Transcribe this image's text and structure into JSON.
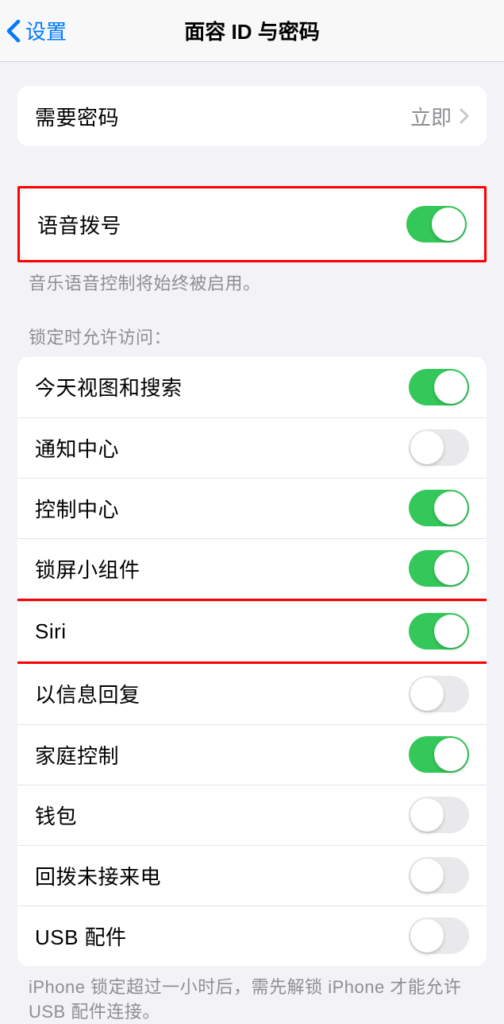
{
  "nav": {
    "back_label": "设置",
    "title": "面容 ID 与密码"
  },
  "require_passcode": {
    "label": "需要密码",
    "value": "立即"
  },
  "voice_dial": {
    "label": "语音拨号",
    "enabled": true,
    "footer": "音乐语音控制将始终被启用。"
  },
  "lock_access": {
    "header": "锁定时允许访问：",
    "items": [
      {
        "label": "今天视图和搜索",
        "enabled": true
      },
      {
        "label": "通知中心",
        "enabled": false
      },
      {
        "label": "控制中心",
        "enabled": true
      },
      {
        "label": "锁屏小组件",
        "enabled": true
      },
      {
        "label": "Siri",
        "enabled": true
      },
      {
        "label": "以信息回复",
        "enabled": false
      },
      {
        "label": "家庭控制",
        "enabled": true
      },
      {
        "label": "钱包",
        "enabled": false
      },
      {
        "label": "回拨未接来电",
        "enabled": false
      },
      {
        "label": "USB 配件",
        "enabled": false
      }
    ],
    "footer": "iPhone 锁定超过一小时后，需先解锁 iPhone 才能允许USB 配件连接。"
  },
  "highlights": {
    "voice_dial": true,
    "siri_index": 4
  }
}
